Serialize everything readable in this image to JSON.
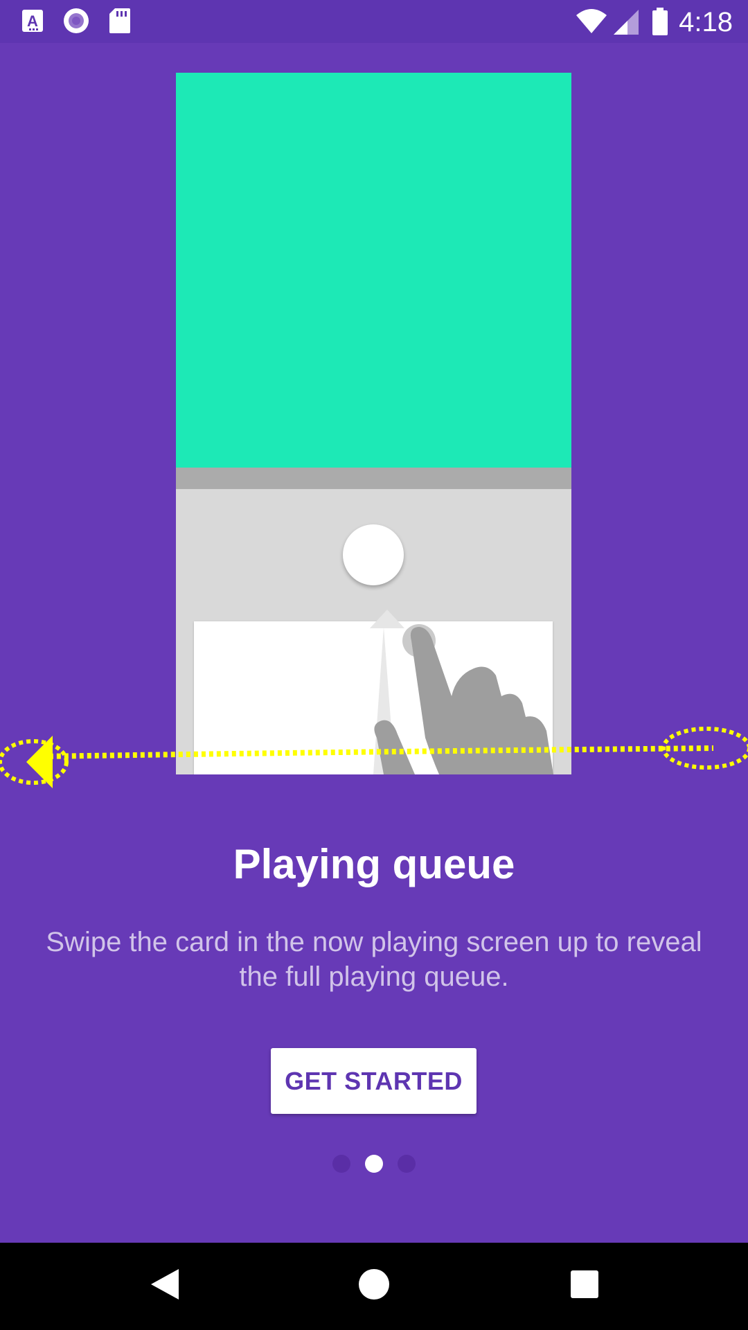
{
  "status_bar": {
    "time": "4:18",
    "left_icons": [
      "accessibility-a-icon",
      "record-icon",
      "sd-card-icon"
    ],
    "right_icons": [
      "wifi-icon",
      "cellular-signal-icon",
      "battery-icon"
    ]
  },
  "onboarding": {
    "title": "Playing queue",
    "description": "Swipe the card in the now playing screen up to reveal the full playing queue.",
    "button_label": "GET STARTED",
    "page_count": 3,
    "active_page": 2
  },
  "colors": {
    "background": "#673AB7",
    "status_bar": "#5E35B1",
    "art": "#1DE9B6",
    "button_text": "#5E35B1",
    "swipe_annotation": "#FFFF00"
  },
  "nav_bar": {
    "buttons": [
      "back-icon",
      "home-icon",
      "recents-icon"
    ]
  }
}
